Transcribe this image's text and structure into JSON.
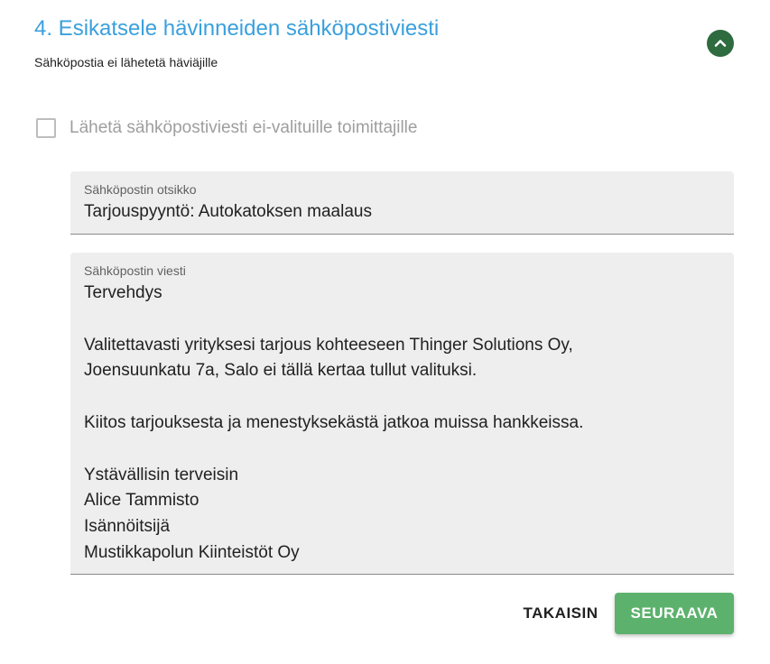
{
  "section": {
    "title": "4. Esikatsele hävinneiden sähköpostiviesti",
    "subtitle": "Sähköpostia ei lähetetä häviäjille"
  },
  "checkbox": {
    "label": "Lähetä sähköpostiviesti ei-valituille toimittajille",
    "checked": false
  },
  "subject_field": {
    "label": "Sähköpostin otsikko",
    "value": "Tarjouspyyntö: Autokatoksen maalaus"
  },
  "message_field": {
    "label": "Sähköpostin viesti",
    "lines": [
      "Tervehdys",
      "",
      "Valitettavasti yrityksesi tarjous kohteeseen Thinger Solutions Oy,",
      "Joensuunkatu 7a, Salo ei tällä kertaa tullut valituksi.",
      "",
      "Kiitos tarjouksesta ja menestyksekästä jatkoa muissa hankkeissa.",
      "",
      "Ystävällisin terveisin",
      "Alice Tammisto",
      "Isännöitsijä",
      "Mustikkapolun Kiinteistöt Oy"
    ]
  },
  "buttons": {
    "back_label": "TAKAISIN",
    "next_label": "SEURAAVA"
  },
  "icons": {
    "collapse": "chevron-up-icon"
  },
  "colors": {
    "title": "#3aa0dd",
    "collapse_button": "#2e6b3f",
    "primary_button": "#5cb26d"
  }
}
